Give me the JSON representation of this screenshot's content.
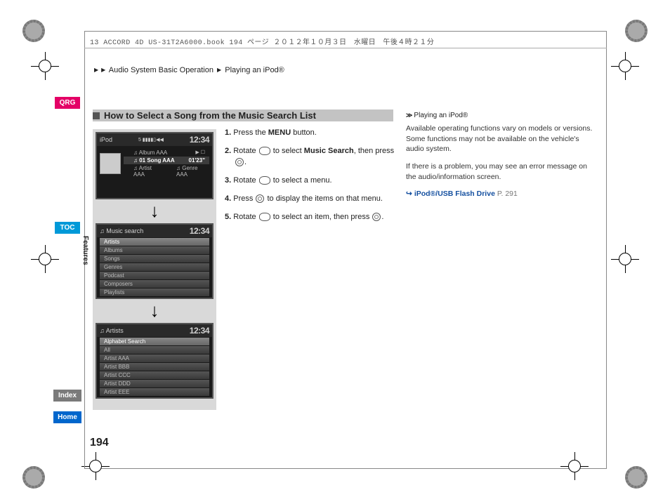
{
  "header": {
    "meta_line": "13 ACCORD 4D US-31T2A6000.book  194 ページ  ２０１２年１０月３日　水曜日　午後４時２１分"
  },
  "breadcrumb": {
    "a": "Audio System Basic Operation",
    "b": "Playing an iPod®"
  },
  "nav": {
    "qrg": "QRG",
    "toc": "TOC",
    "index": "Index",
    "home": "Home",
    "section": "Features"
  },
  "page_number": "194",
  "section_title": "How to Select a Song from the Music Search List",
  "steps": {
    "s1_a": "1. ",
    "s1_b": "Press the ",
    "s1_menu": "MENU",
    "s1_c": " button.",
    "s2_a": "2. ",
    "s2_b": "Rotate ",
    "s2_c": " to select ",
    "s2_ms": "Music Search",
    "s2_d": ", then press ",
    "s2_e": ".",
    "s3_a": "3. ",
    "s3_b": "Rotate ",
    "s3_c": " to select a menu.",
    "s4_a": "4. ",
    "s4_b": "Press ",
    "s4_c": " to display the items on that menu.",
    "s5_a": "5. ",
    "s5_b": "Rotate ",
    "s5_c": " to select an item, then press ",
    "s5_d": "."
  },
  "screen1": {
    "title": "iPod",
    "clock": "12:34",
    "wifi": "5 ▮▮▮▮▯◀◀",
    "r1": "♫ Album AAA",
    "r1_right": "▶ ☐",
    "r2": "♫ 01 Song AAA",
    "r2_right": "01'23\"",
    "r3a": "♫ Artist AAA",
    "r3b": "♫ Genre AAA"
  },
  "screen2": {
    "title": "♫ Music search",
    "clock": "12:34",
    "items": [
      "Artists",
      "Albums",
      "Songs",
      "Genres",
      "Podcast",
      "Composers",
      "Playlists"
    ]
  },
  "screen3": {
    "title": "♫ Artists",
    "clock": "12:34",
    "items": [
      "Alphabet Search",
      "All",
      "Artist AAA",
      "Artist BBB",
      "Artist CCC",
      "Artist DDD",
      "Artist EEE"
    ]
  },
  "right": {
    "hdr_label": "Playing an iPod®",
    "p1": "Available operating functions vary on models or versions. Some functions may not be available on the vehicle's audio system.",
    "p2": "If there is a problem, you may see an error message on the audio/information screen.",
    "xref_label": "iPod®/USB Flash Drive",
    "xref_page": "P. 291"
  }
}
